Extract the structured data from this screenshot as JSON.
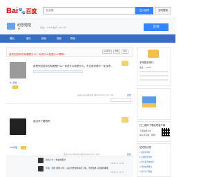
{
  "header": {
    "logo_text_1": "Bai",
    "logo_paw": "🐾",
    "logo_text_2": "百度",
    "search_value": "纪念馆",
    "search_button": "进入贴吧",
    "search_button_2": "全吧搜索"
  },
  "forum": {
    "name": "纪念馆吧",
    "stats": "关注：1,245  帖子：85,472",
    "sign_button": "签到"
  },
  "nav": {
    "items": [
      "看贴",
      "图片",
      "精品",
      "视频",
      "群组"
    ]
  },
  "post": {
    "title": "我来回答你的标题是什么？你说什么就是什么啊啊...",
    "actions": [
      "只看楼主",
      "收藏",
      "回复"
    ]
  },
  "posts": [
    {
      "username": "Hi_奇妙",
      "content": "我是来回答你的标题是什么？你说什么就是什么，不过我觉得不一定对吧...",
      "meta": "来自Android客户端  1楼  2018-07-02 17:03",
      "reply_link": "回复"
    },
    {
      "username": "iOS熊猫",
      "content": "我过来了看看吧",
      "meta": "来自Android客户端  2楼  2018-07-02 17:06",
      "reply_link": "回复"
    }
  ],
  "replies": [
    {
      "username": "网络小伙",
      "content": "你说的都对",
      "time": "2018-7-2 17:06"
    },
    {
      "username": "熊猫",
      "content": "回复 网络小伙：以后不要这样说话了吧，不然会被人拉黑的哦哦",
      "time": "2018-7-2 17:11"
    }
  ],
  "sidebar": {
    "rank_title": "本吧签到排行",
    "rank_text": "会员：1,024",
    "app_title": "扫二维码下载贴吧客户端",
    "app_text": "下载贴吧APP",
    "app_text_2": "看高清直播、视频！",
    "hot_title": "贴吧热议榜",
    "hot_items": [
      "1  最新世界杯",
      "2  比赛结果出炉",
      "3  纪念馆开放时间",
      "4  周末去哪里玩",
      "5  新手入门指南"
    ]
  }
}
